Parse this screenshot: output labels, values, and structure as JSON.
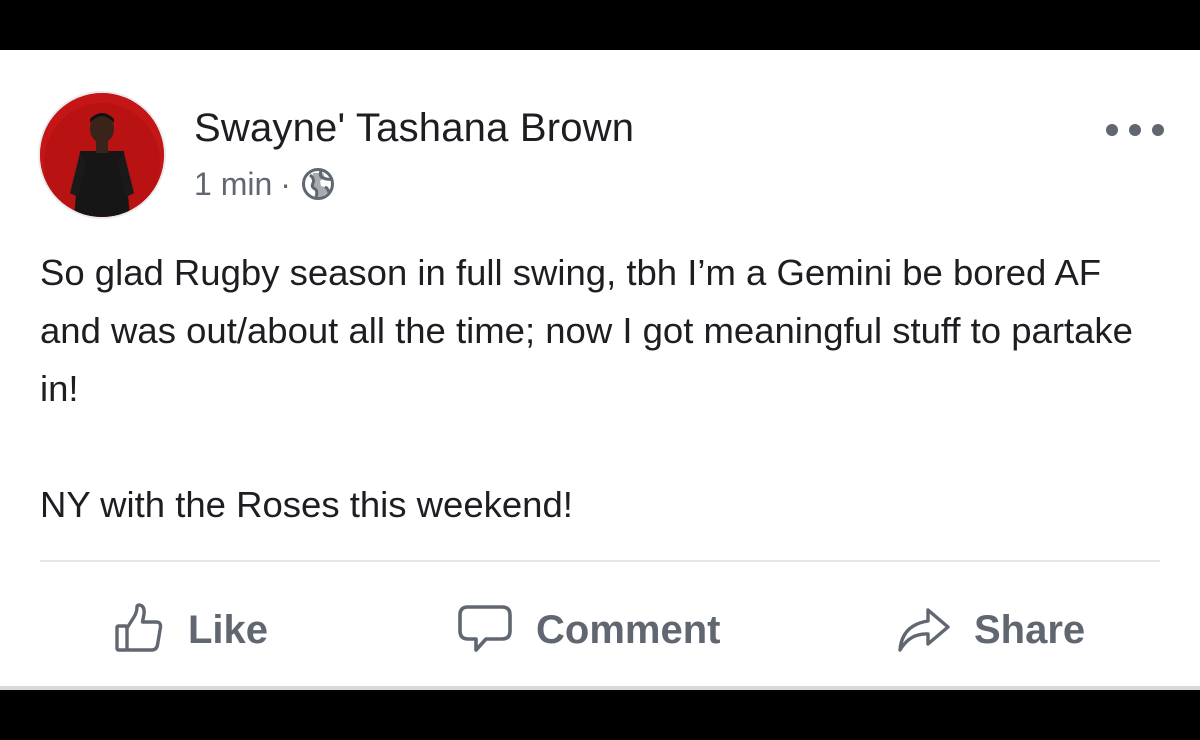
{
  "post": {
    "author_name": "Swayne' Tashana Brown",
    "timestamp": "1 min",
    "separator": "·",
    "privacy_icon": "globe-icon",
    "more_icon": "more-options-icon",
    "body_paragraphs": [
      "So glad Rugby season in full swing, tbh I’m a Gemini be bored AF and was out/about all the time; now I got meaningful stuff to partake in!",
      "NY with the Roses this weekend!"
    ]
  },
  "actions": {
    "like_label": "Like",
    "like_icon": "thumbs-up-icon",
    "comment_label": "Comment",
    "comment_icon": "comment-bubble-icon",
    "share_label": "Share",
    "share_icon": "share-arrow-icon"
  },
  "colors": {
    "text_primary": "#1c1e21",
    "text_secondary": "#606770",
    "background": "#ffffff",
    "frame": "#000000"
  }
}
